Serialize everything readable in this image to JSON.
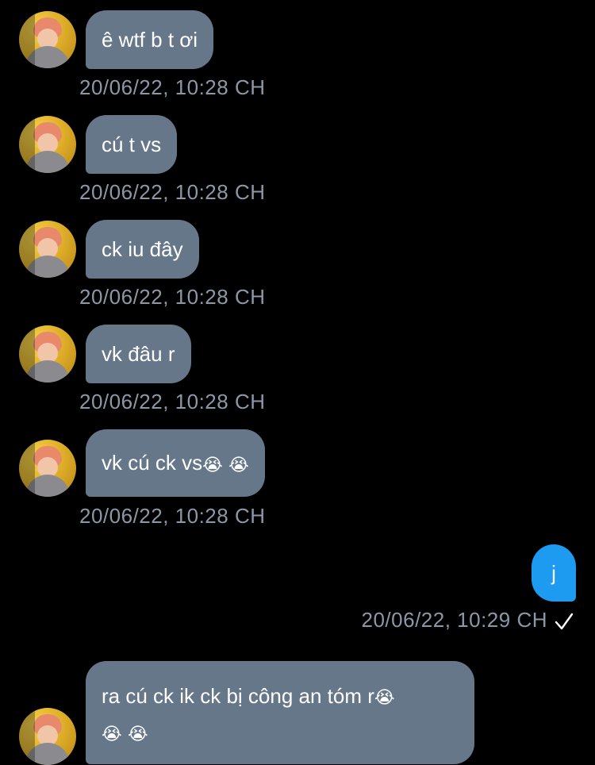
{
  "messages": [
    {
      "text": "ê wtf b t ơi",
      "time": "20/06/22, 10:28 CH"
    },
    {
      "text": "cú t vs",
      "time": "20/06/22, 10:28 CH"
    },
    {
      "text": "ck iu đây",
      "time": "20/06/22, 10:28 CH"
    },
    {
      "text": "vk đâu r",
      "time": "20/06/22, 10:28 CH"
    },
    {
      "text": "vk cú ck vs",
      "emoji_a": "😭",
      "emoji_b": "😭",
      "time": "20/06/22, 10:28 CH"
    }
  ],
  "outgoing": {
    "text": "j",
    "time": "20/06/22, 10:29 CH",
    "status_icon": "check-icon"
  },
  "last_message": {
    "text": "ra cú ck ik ck bị công an tóm r",
    "emoji_a": "😭",
    "emoji_b": "😭",
    "emoji_c": "😭"
  },
  "colors": {
    "background": "#000000",
    "incoming_bubble": "#67778a",
    "outgoing_bubble": "#1d9bf0",
    "timestamp": "#8a98a8"
  }
}
